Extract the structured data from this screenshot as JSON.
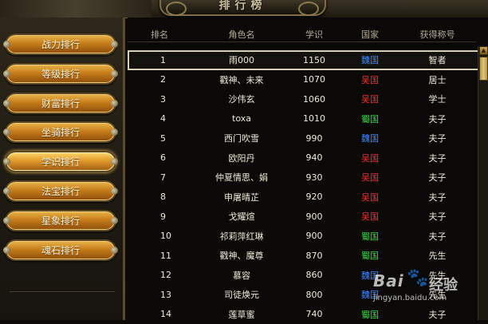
{
  "banner": {
    "title": "排行榜"
  },
  "sidebar": {
    "items": [
      {
        "label": "战力排行",
        "active": false
      },
      {
        "label": "等级排行",
        "active": false
      },
      {
        "label": "财富排行",
        "active": false
      },
      {
        "label": "坐骑排行",
        "active": false
      },
      {
        "label": "学识排行",
        "active": true
      },
      {
        "label": "法宝排行",
        "active": false
      },
      {
        "label": "星象排行",
        "active": false
      },
      {
        "label": "魂石排行",
        "active": false
      }
    ]
  },
  "table": {
    "headers": [
      "排名",
      "角色名",
      "学识",
      "国家",
      "获得称号"
    ],
    "rows": [
      {
        "rank": "1",
        "name": "雨000",
        "score": "1150",
        "nation": "魏国",
        "title": "智者",
        "selected": true
      },
      {
        "rank": "2",
        "name": "戳神、未来",
        "score": "1070",
        "nation": "吴国",
        "title": "居士"
      },
      {
        "rank": "3",
        "name": "沙伟玄",
        "score": "1060",
        "nation": "吴国",
        "title": "学士"
      },
      {
        "rank": "4",
        "name": "toxa",
        "score": "1010",
        "nation": "蜀国",
        "title": "夫子"
      },
      {
        "rank": "5",
        "name": "西门吹雪",
        "score": "990",
        "nation": "魏国",
        "title": "夫子"
      },
      {
        "rank": "6",
        "name": "欧阳丹",
        "score": "940",
        "nation": "吴国",
        "title": "夫子"
      },
      {
        "rank": "7",
        "name": "仲夏情思、娟",
        "score": "930",
        "nation": "吴国",
        "title": "夫子"
      },
      {
        "rank": "8",
        "name": "申屠晴芷",
        "score": "920",
        "nation": "吴国",
        "title": "夫子"
      },
      {
        "rank": "9",
        "name": "戈耀煊",
        "score": "900",
        "nation": "吴国",
        "title": "夫子"
      },
      {
        "rank": "10",
        "name": "祁莉萍红琳",
        "score": "900",
        "nation": "蜀国",
        "title": "夫子"
      },
      {
        "rank": "11",
        "name": "戳神、魔尊",
        "score": "870",
        "nation": "蜀国",
        "title": "先生"
      },
      {
        "rank": "12",
        "name": "慕容",
        "score": "860",
        "nation": "魏国",
        "title": "先生"
      },
      {
        "rank": "13",
        "name": "司徒焕元",
        "score": "800",
        "nation": "魏国",
        "title": "先生"
      },
      {
        "rank": "14",
        "name": "莲草蜜",
        "score": "740",
        "nation": "蜀国",
        "title": "夫子"
      }
    ]
  },
  "nation_colors": {
    "魏国": "#3b8cff",
    "吴国": "#ff2b2b",
    "蜀国": "#2ee03a"
  },
  "watermark": {
    "brand": "Bai",
    "product": "经验",
    "url": "jingyan.baidu.com"
  }
}
